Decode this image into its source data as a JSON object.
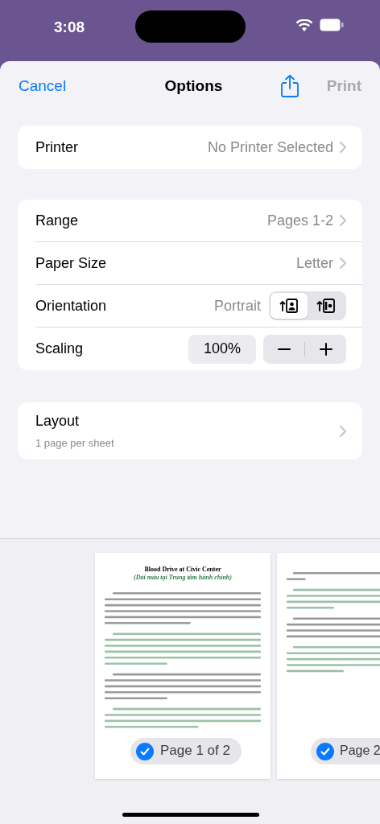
{
  "status_bar": {
    "time": "3:08"
  },
  "header": {
    "cancel": "Cancel",
    "title": "Options",
    "print": {
      "label": "Print",
      "disabled": true
    }
  },
  "printer": {
    "label": "Printer",
    "value": "No Printer Selected"
  },
  "options": [
    {
      "kind": "value",
      "label": "Range",
      "value": "Pages 1-2"
    },
    {
      "kind": "value",
      "label": "Paper Size",
      "value": "Letter"
    },
    {
      "kind": "orientation",
      "label": "Orientation",
      "value": "Portrait",
      "choices": [
        {
          "kind": "portrait",
          "selected": true
        },
        {
          "kind": "landscape",
          "selected": false
        }
      ]
    },
    {
      "kind": "scaling",
      "label": "Scaling",
      "value": "100%"
    }
  ],
  "layout": {
    "label": "Layout",
    "subtitle": "1 page per sheet"
  },
  "previews": [
    {
      "badge": "Page 1 of 2",
      "checked": true,
      "title": "Blood Drive at Civic Center",
      "subtitle": "(Dải máu tại Trung tâm hành chính)"
    },
    {
      "badge": "Page 2",
      "checked": true
    }
  ]
}
